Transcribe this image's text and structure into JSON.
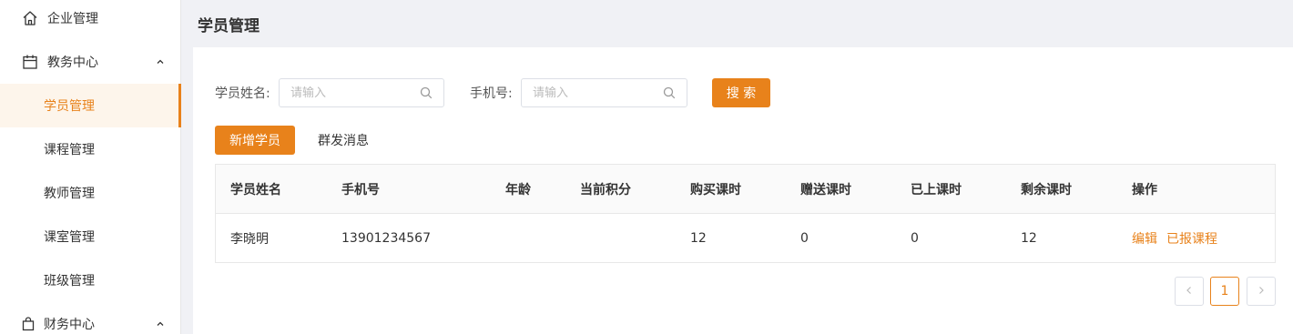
{
  "sidebar": {
    "top_item": {
      "label": "企业管理",
      "icon": "home-icon"
    },
    "groups": [
      {
        "label": "教务中心",
        "icon": "calendar-icon",
        "expanded": true,
        "items": [
          {
            "label": "学员管理",
            "active": true
          },
          {
            "label": "课程管理",
            "active": false
          },
          {
            "label": "教师管理",
            "active": false
          },
          {
            "label": "课室管理",
            "active": false
          },
          {
            "label": "班级管理",
            "active": false
          }
        ]
      },
      {
        "label": "财务中心",
        "icon": "bag-icon",
        "expanded": true
      }
    ]
  },
  "header": {
    "title": "学员管理"
  },
  "search": {
    "name_label": "学员姓名:",
    "name_placeholder": "请输入",
    "phone_label": "手机号:",
    "phone_placeholder": "请输入",
    "search_button": "搜 索"
  },
  "actions": {
    "add_button": "新增学员",
    "broadcast_button": "群发消息"
  },
  "table": {
    "columns": [
      "学员姓名",
      "手机号",
      "年龄",
      "当前积分",
      "购买课时",
      "赠送课时",
      "已上课时",
      "剩余课时",
      "操作"
    ],
    "rows": [
      {
        "name": "李晓明",
        "phone": "13901234567",
        "age": "",
        "points": "",
        "purchased": "12",
        "gifted": "0",
        "attended": "0",
        "remaining": "12",
        "ops": [
          "编辑",
          "已报课程"
        ]
      }
    ]
  },
  "pagination": {
    "current": "1"
  },
  "colors": {
    "accent": "#e8821b",
    "active_bg": "#fdf5eb"
  }
}
